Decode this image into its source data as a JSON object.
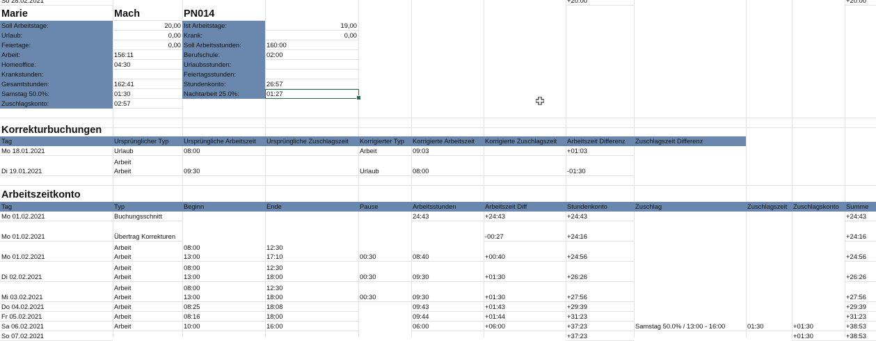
{
  "top_row": {
    "day": "So 28.02.2021",
    "value1": "+20:00",
    "value2": "+20:00"
  },
  "employee": {
    "first_name": "Marie",
    "last_name": "Mach",
    "id": "PN014"
  },
  "summary": {
    "left": [
      {
        "label": "Soll Arbeitstage:",
        "value": "20,00"
      },
      {
        "label": "Urlaub:",
        "value": "0,00"
      },
      {
        "label": "Feiertage:",
        "value": "0,00"
      },
      {
        "label": "Arbeit:",
        "value": "156:11"
      },
      {
        "label": "Homeoffice:",
        "value": "04:30"
      },
      {
        "label": "Krankstunden:",
        "value": ""
      },
      {
        "label": "Gesamtstunden:",
        "value": "162:41"
      },
      {
        "label": "Samstag 50.0%:",
        "value": "01:30"
      },
      {
        "label": "Zuschlagskonto:",
        "value": "02:57"
      }
    ],
    "right": [
      {
        "label": "Ist Arbeitstage:",
        "value": "19,00"
      },
      {
        "label": "Krank:",
        "value": "0,00"
      },
      {
        "label": "Soll Arbeitsstunden:",
        "value": "160:00"
      },
      {
        "label": "Berufschule:",
        "value": "02:00"
      },
      {
        "label": "Urlaubsstunden:",
        "value": ""
      },
      {
        "label": "Feiertagsstunden:",
        "value": ""
      },
      {
        "label": "Stundenkonto:",
        "value": "26:57"
      },
      {
        "label": "Nachtarbeit 25.0%:",
        "value": "01:27"
      }
    ]
  },
  "korrektur": {
    "title": "Korrekturbuchungen",
    "headers": [
      "Tag",
      "Ursprünglicher Typ",
      "Ursprüngliche Arbeitszeit",
      "Ursprüngliche Zuschlagszeit",
      "Korrigierter Typ",
      "Korrigierte Arbeitszeit",
      "Korrigierte Zuschlagszeit",
      "Arbeitszeit Differenz",
      "Zuschlagszeit Differenz"
    ],
    "row1": {
      "tag": "Mo 18.01.2021",
      "typ": "Urlaub",
      "az": "08:00",
      "ktyp": "Arbeit",
      "kaz": "09:03",
      "diff": "+01:03"
    },
    "row2": {
      "tag": "Di 19.01.2021",
      "typ_top": "Arbeit",
      "typ": "Arbeit",
      "az": "09:30",
      "ktyp": "Urlaub",
      "kaz": "08:00",
      "diff": "-01:30"
    }
  },
  "konto": {
    "title": "Arbeitszeitkonto",
    "headers": [
      "Tag",
      "Typ",
      "Beginn",
      "Ende",
      "Pause",
      "Arbeitsstunden",
      "Arbeitszeit Diff",
      "Stundenkonto",
      "Zuschlag",
      "Zuschlagszeit",
      "Zuschlagskonto",
      "Summe"
    ],
    "r1": {
      "tag": "Mo 01.02.2021",
      "typ": "Buchungsschnitt",
      "as": "24:43",
      "diff": "+24:43",
      "konto": "+24:43",
      "summe": "+24:43"
    },
    "r2": {
      "tag": "Mo 01.02.2021",
      "typ": "Übertrag Korrekturen",
      "diff": "-00:27",
      "konto": "+24:16",
      "summe": "+24:16"
    },
    "r3": {
      "tag": "Mo 01.02.2021",
      "typ1": "Arbeit",
      "typ2": "Arbeit",
      "b1": "08:00",
      "b2": "13:00",
      "e1": "12:30",
      "e2": "17:10",
      "pause": "00:30",
      "as": "08:40",
      "diff": "+00:40",
      "konto": "+24:56",
      "summe": "+24:56"
    },
    "r4": {
      "tag": "Di 02.02.2021",
      "typ1": "Arbeit",
      "typ2": "Arbeit",
      "b1": "08:00",
      "b2": "13:00",
      "e1": "12:30",
      "e2": "18:00",
      "pause": "00:30",
      "as": "09:30",
      "diff": "+01:30",
      "konto": "+26:26",
      "summe": "+26:26"
    },
    "r5": {
      "tag": "Mi 03.02.2021",
      "typ1": "Arbeit",
      "typ2": "Arbeit",
      "b1": "08:00",
      "b2": "13:00",
      "e1": "12:30",
      "e2": "18:00",
      "pause": "00:30",
      "as": "09:30",
      "diff": "+01:30",
      "konto": "+27:56",
      "summe": "+27:56"
    },
    "r6": {
      "tag": "Do 04.02.2021",
      "typ": "Arbeit",
      "b": "08:25",
      "e": "18:08",
      "as": "09:43",
      "diff": "+01:43",
      "konto": "+29:39",
      "summe": "+29:39"
    },
    "r7": {
      "tag": "Fr 05.02.2021",
      "typ": "Arbeit",
      "b": "08:16",
      "e": "18:00",
      "as": "09:44",
      "diff": "+01:44",
      "konto": "+31:23",
      "summe": "+31:23"
    },
    "r8": {
      "tag": "Sa 06.02.2021",
      "typ": "Arbeit",
      "b": "10:00",
      "e": "16:00",
      "as": "06:00",
      "diff": "+06:00",
      "konto": "+37:23",
      "zuschlag": "Samstag 50.0% / 13:00 - 16:00",
      "zz": "01:30",
      "zk": "+01:30",
      "summe": "+38:53"
    },
    "r9": {
      "tag": "So 07.02.2021",
      "konto": "+37:23",
      "zk": "+01:30",
      "summe": "+38:53"
    }
  },
  "colors": {
    "header_bg": "#6a88ad",
    "selection": "#1e7145",
    "gridline": "#e2e2e2"
  }
}
